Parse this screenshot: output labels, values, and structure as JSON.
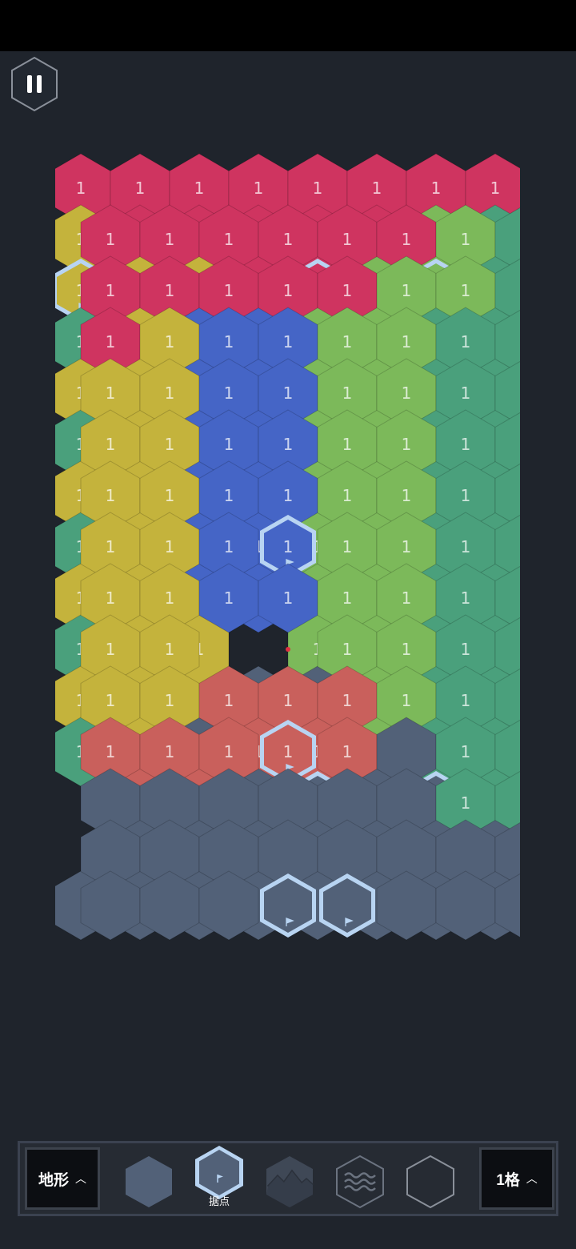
{
  "board": {
    "cell_label": "1",
    "colors": {
      "red": "#cf3460",
      "green": "#7cb95a",
      "teal": "#4aa07c",
      "yellow": "#c4b33c",
      "blue": "#4565c6",
      "salmon": "#c9605c",
      "gray": "#526178",
      "base_outline": "#b8d4f2"
    }
  },
  "toolbar": {
    "terrain_label": "地形",
    "tools": [
      {
        "name": "plain",
        "icon": "hex-plain-icon"
      },
      {
        "name": "base",
        "icon": "hex-flag-icon",
        "label": "据点",
        "selected": true
      },
      {
        "name": "mountain",
        "icon": "hex-mountain-icon"
      },
      {
        "name": "water",
        "icon": "hex-wave-icon"
      },
      {
        "name": "empty",
        "icon": "hex-outline-icon"
      }
    ],
    "size_label": "1格"
  }
}
